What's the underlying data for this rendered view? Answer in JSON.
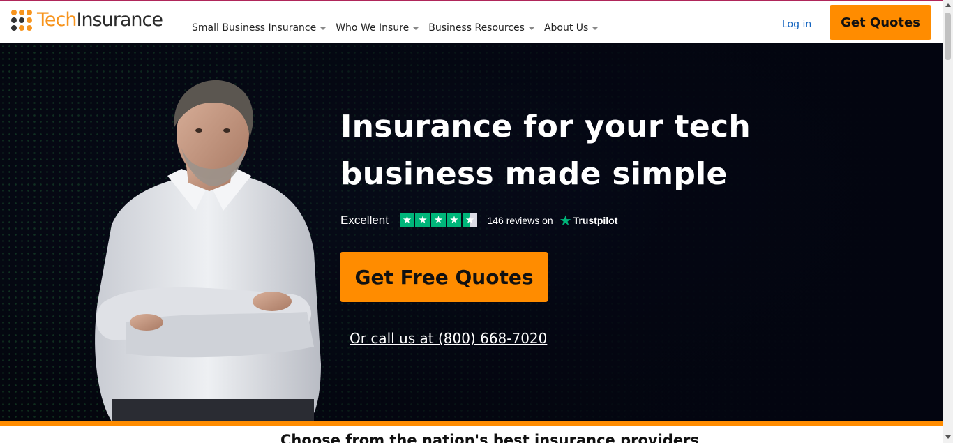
{
  "colors": {
    "brand_orange": "#ff8c00",
    "logo_orange": "#f7941d",
    "logo_dark": "#2b2b2b",
    "link_blue": "#1565c0",
    "trustpilot_green": "#00b67a",
    "hero_bg": "#050816"
  },
  "logo": {
    "part1": "Tech",
    "part2": "Insurance",
    "dot_colors": [
      "#f7941d",
      "#f7941d",
      "#f7941d",
      "#333333",
      "#333333",
      "#f7941d",
      "#333333",
      "#f7941d",
      "#f7941d"
    ]
  },
  "nav": {
    "items": [
      {
        "label": "Small Business Insurance",
        "icon": "chevron-down-icon"
      },
      {
        "label": "Who We Insure",
        "icon": "chevron-down-icon"
      },
      {
        "label": "Business Resources",
        "icon": "chevron-down-icon"
      },
      {
        "label": "About Us",
        "icon": "chevron-down-icon"
      }
    ],
    "login_label": "Log in",
    "get_quotes_label": "Get Quotes"
  },
  "hero": {
    "headline_line1": "Insurance for your tech",
    "headline_line2": "business made simple",
    "rating": {
      "word": "Excellent",
      "stars": 4.5,
      "reviews_text": "146 reviews on",
      "provider": "Trustpilot"
    },
    "cta_label": "Get Free Quotes",
    "call_text": "Or call us at (800) 668-7020"
  },
  "below": {
    "title": "Choose from the nation's best insurance providers"
  }
}
